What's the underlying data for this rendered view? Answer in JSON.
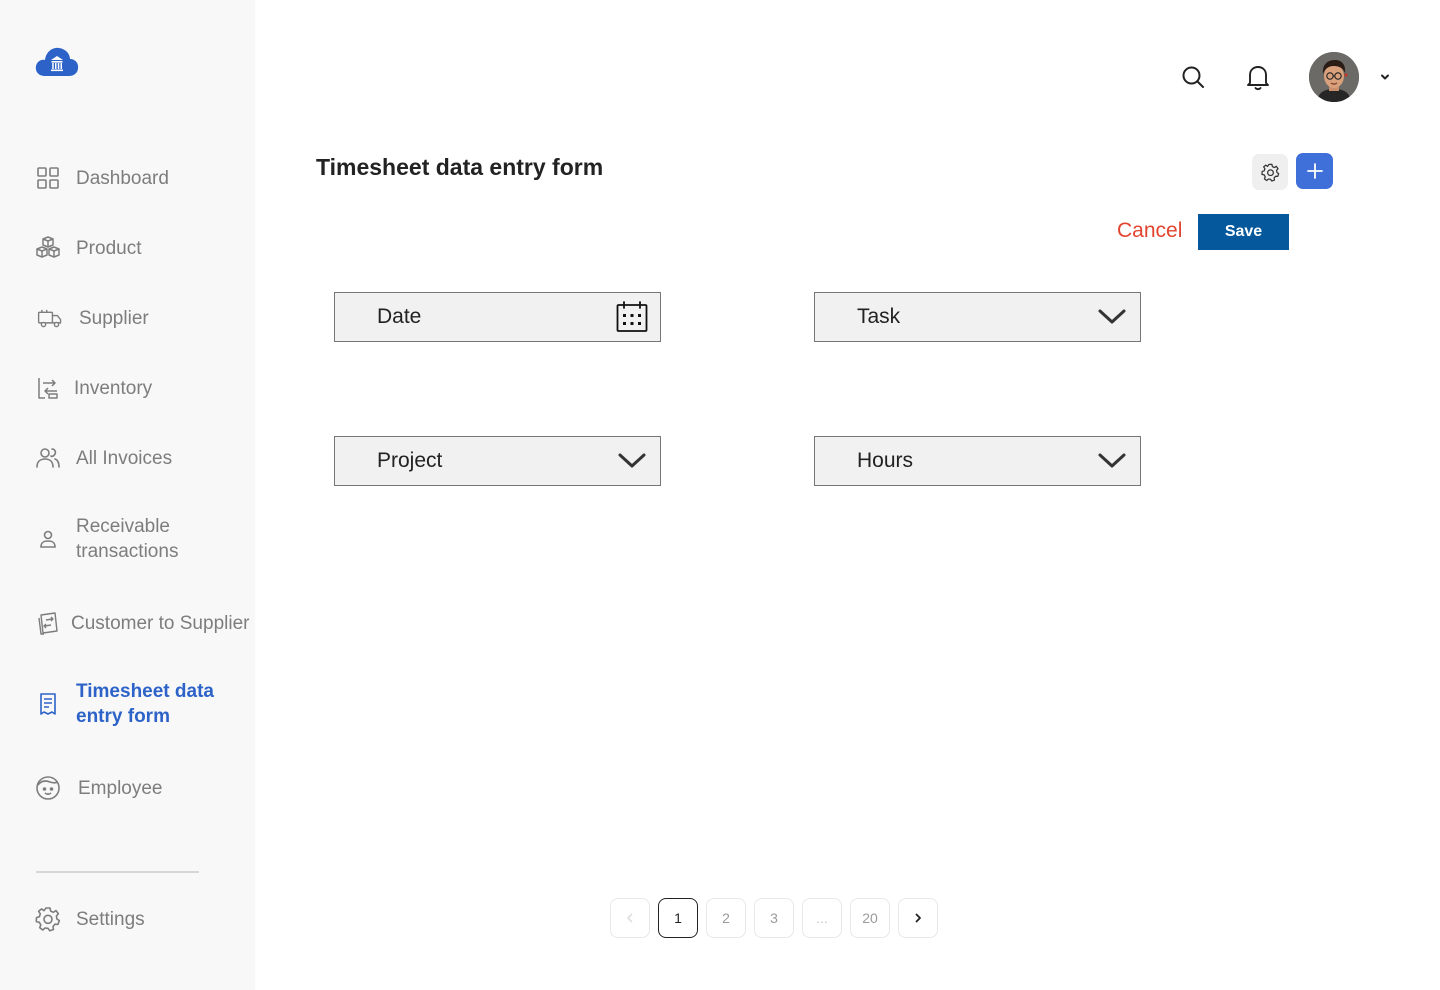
{
  "sidebar": {
    "items": [
      {
        "label": "Dashboard",
        "icon": "grid-icon"
      },
      {
        "label": "Product",
        "icon": "boxes-icon"
      },
      {
        "label": "Supplier",
        "icon": "truck-icon"
      },
      {
        "label": "Inventory",
        "icon": "transfer-icon"
      },
      {
        "label": "All Invoices",
        "icon": "users-icon"
      },
      {
        "label": "Receivable transactions",
        "icon": "person-icon"
      },
      {
        "label": "Customer to Supplier",
        "icon": "exchange-doc-icon"
      },
      {
        "label": "Timesheet data entry form",
        "icon": "receipt-icon",
        "active": true
      },
      {
        "label": "Employee",
        "icon": "face-icon"
      }
    ],
    "settings_label": "Settings"
  },
  "main": {
    "title": "Timesheet data entry form",
    "cancel_label": "Cancel",
    "save_label": "Save",
    "fields": {
      "date": "Date",
      "task": "Task",
      "project": "Project",
      "hours": "Hours"
    }
  },
  "pagination": {
    "pages": [
      "1",
      "2",
      "3",
      "...",
      "20"
    ],
    "current": "1"
  },
  "colors": {
    "accent": "#2d63c8",
    "save": "#05589c",
    "cancel": "#e2452f",
    "plus": "#3f6fd8"
  }
}
